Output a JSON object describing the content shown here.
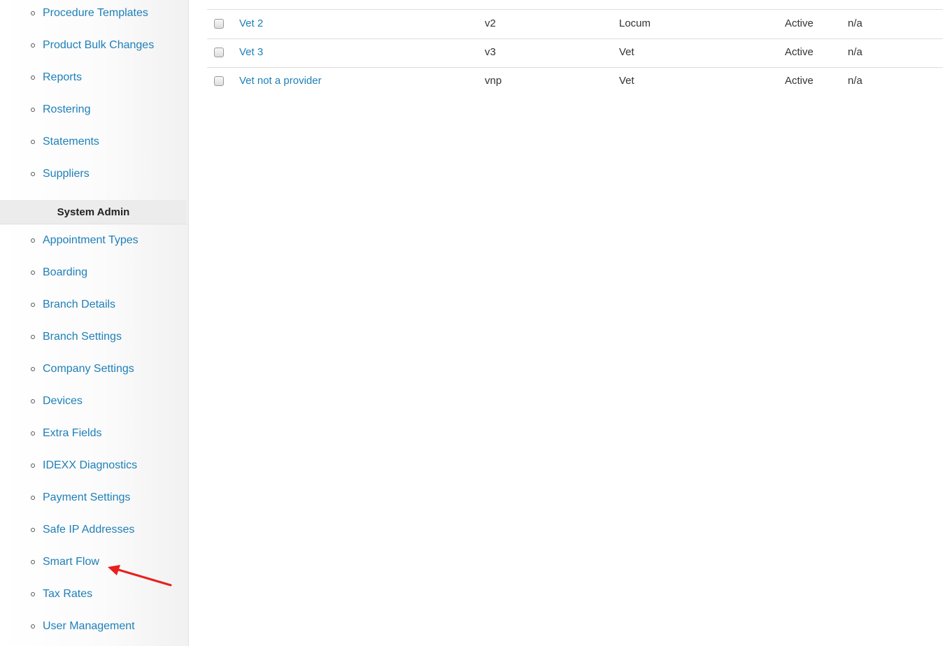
{
  "sidebar": {
    "top_items": [
      {
        "label": "Procedure Templates"
      },
      {
        "label": "Product Bulk Changes"
      },
      {
        "label": "Reports"
      },
      {
        "label": "Rostering"
      },
      {
        "label": "Statements"
      },
      {
        "label": "Suppliers"
      }
    ],
    "section_title": "System Admin",
    "admin_items": [
      {
        "label": "Appointment Types"
      },
      {
        "label": "Boarding"
      },
      {
        "label": "Branch Details"
      },
      {
        "label": "Branch Settings"
      },
      {
        "label": "Company Settings"
      },
      {
        "label": "Devices"
      },
      {
        "label": "Extra Fields"
      },
      {
        "label": "IDEXX Diagnostics"
      },
      {
        "label": "Payment Settings"
      },
      {
        "label": "Safe IP Addresses"
      },
      {
        "label": "Smart Flow"
      },
      {
        "label": "Tax Rates"
      },
      {
        "label": "User Management"
      }
    ]
  },
  "table": {
    "rows": [
      {
        "name": "Vet 2",
        "code": "v2",
        "type": "Locum",
        "status": "Active",
        "extra": "n/a"
      },
      {
        "name": "Vet 3",
        "code": "v3",
        "type": "Vet",
        "status": "Active",
        "extra": "n/a"
      },
      {
        "name": "Vet not a provider",
        "code": "vnp",
        "type": "Vet",
        "status": "Active",
        "extra": "n/a"
      }
    ]
  },
  "annotation": {
    "arrow_color": "#e8201e",
    "arrow_target": "Smart Flow"
  },
  "colors": {
    "link": "#1e7fb8",
    "section_bg": "#ececec",
    "divider": "#dddddd"
  }
}
